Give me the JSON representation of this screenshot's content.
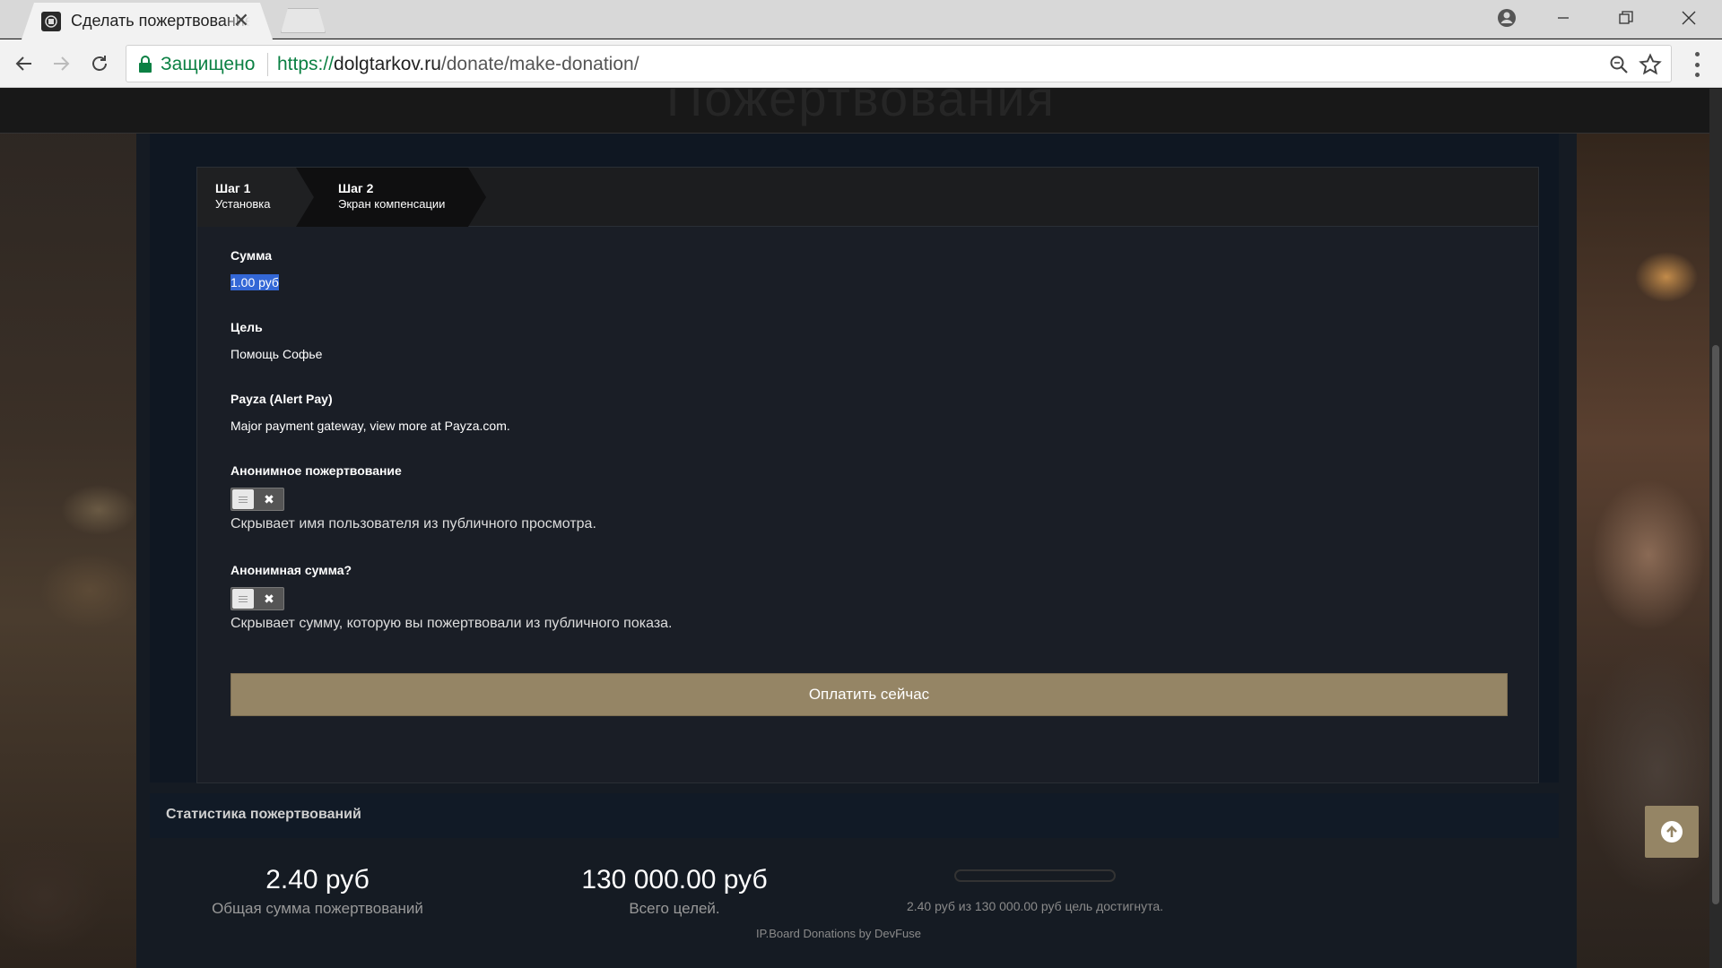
{
  "browser": {
    "tab_title": "Сделать пожертвование",
    "secure_label": "Защищено",
    "url_scheme": "https://",
    "url_host": "dolgtarkov.ru",
    "url_path": "/donate/make-donation/"
  },
  "page": {
    "banner_title": "Пожертвования"
  },
  "wizard": {
    "steps": [
      {
        "number": "Шаг 1",
        "label": "Установка"
      },
      {
        "number": "Шаг 2",
        "label": "Экран компенсации"
      }
    ],
    "amount": {
      "label": "Сумма",
      "value": "1.00 руб"
    },
    "goal": {
      "label": "Цель",
      "value": "Помощь Софье"
    },
    "gateway": {
      "label": "Payza (Alert Pay)",
      "value": "Major payment gateway, view more at Payza.com."
    },
    "anon_donation": {
      "label": "Анонимное пожертвование",
      "toggle_off": "✖",
      "description": "Скрывает имя пользователя из публичного просмотра."
    },
    "anon_amount": {
      "label": "Анонимная сумма?",
      "toggle_off": "✖",
      "description": "Скрывает сумму, которую вы пожертвовали из публичного показа."
    },
    "pay_button": "Оплатить сейчас"
  },
  "stats": {
    "header": "Статистика пожертвований",
    "total_value": "2.40 руб",
    "total_label": "Общая сумма пожертвований",
    "goal_value": "130 000.00 руб",
    "goal_label": "Всего целей.",
    "progress_fraction": 1.85e-05,
    "progress_text": "2.40 руб из 130 000.00 руб цель достигнута.",
    "credit": "IP.Board Donations by DevFuse"
  },
  "colors": {
    "accent": "#958565",
    "secure_green": "#0b8043",
    "selection": "#3367d6"
  },
  "icons": [
    "favicon-icon",
    "tab-close-icon",
    "user-icon",
    "minimize-icon",
    "maximize-icon",
    "window-close-icon",
    "back-icon",
    "forward-icon",
    "reload-icon",
    "lock-icon",
    "zoom-icon",
    "star-icon",
    "menu-icon",
    "arrow-up-icon"
  ]
}
